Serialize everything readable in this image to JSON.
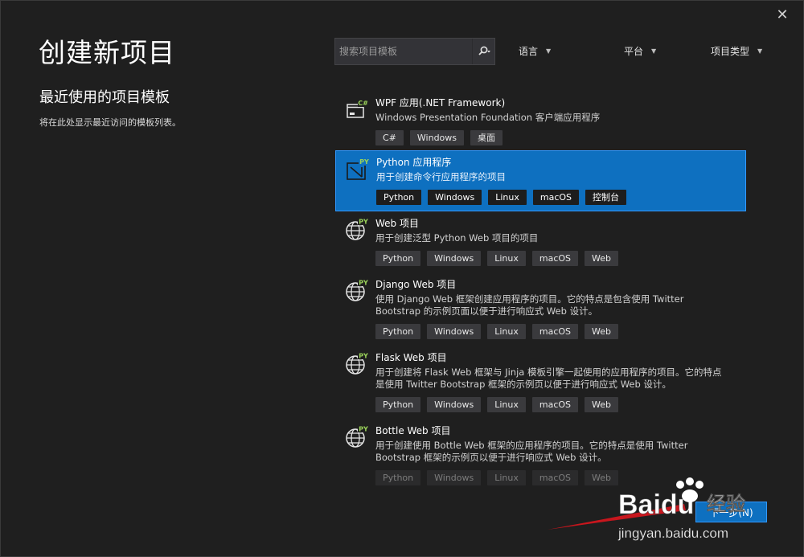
{
  "window": {
    "title": "创建新项目",
    "close_symbol": "✕"
  },
  "recent": {
    "title": "最近使用的项目模板",
    "description": "将在此处显示最近访问的模板列表。"
  },
  "search": {
    "placeholder": "搜索项目模板",
    "icon": "search-icon"
  },
  "filters": {
    "language": "语言",
    "platform": "平台",
    "project_type": "项目类型"
  },
  "templates": [
    {
      "name": "WPF 应用(.NET Framework)",
      "description_lines": [
        "Windows Presentation Foundation 客户端应用程序"
      ],
      "tags": [
        "C#",
        "Windows",
        "桌面"
      ],
      "icon": "wpf-app-icon",
      "badge": "C#"
    },
    {
      "name": "Python 应用程序",
      "description_lines": [
        "用于创建命令行应用程序的项目"
      ],
      "tags": [
        "Python",
        "Windows",
        "Linux",
        "macOS",
        "控制台"
      ],
      "icon": "python-app-icon",
      "badge": "PY",
      "selected": true
    },
    {
      "name": "Web 项目",
      "description_lines": [
        "用于创建泛型 Python Web 项目的项目"
      ],
      "tags": [
        "Python",
        "Windows",
        "Linux",
        "macOS",
        "Web"
      ],
      "icon": "globe-icon",
      "badge": "PY"
    },
    {
      "name": "Django Web 项目",
      "description_lines": [
        "使用 Django Web 框架创建应用程序的项目。它的特点是包含使用 Twitter",
        "Bootstrap 的示例页面以便于进行响应式 Web 设计。"
      ],
      "tags": [
        "Python",
        "Windows",
        "Linux",
        "macOS",
        "Web"
      ],
      "icon": "globe-icon",
      "badge": "PY"
    },
    {
      "name": "Flask Web 项目",
      "description_lines": [
        "用于创建将 Flask Web 框架与 Jinja 模板引擎一起使用的应用程序的项目。它的特点",
        "是使用 Twitter Bootstrap 框架的示例页以便于进行响应式 Web 设计。"
      ],
      "tags": [
        "Python",
        "Windows",
        "Linux",
        "macOS",
        "Web"
      ],
      "icon": "globe-icon",
      "badge": "PY"
    },
    {
      "name": "Bottle Web 项目",
      "description_lines": [
        "用于创建使用 Bottle Web 框架的应用程序的项目。它的特点是使用 Twitter",
        "Bootstrap 框架的示例页以便于进行响应式 Web 设计。"
      ],
      "tags": [
        "Python",
        "Windows",
        "Linux",
        "macOS",
        "Web"
      ],
      "icon": "globe-icon",
      "badge": "PY",
      "faded_tags": true
    }
  ],
  "footer": {
    "next_label": "下一步(N)"
  },
  "watermark": {
    "brand": "Baidu",
    "brand_cn": "经验",
    "url": "jingyan.baidu.com"
  },
  "colors": {
    "background": "#1f1f1f",
    "accent": "#0e70c0",
    "accent_border": "#3399ff",
    "tag_bg": "#3a3a3d",
    "badge_green": "#9bd35a"
  }
}
